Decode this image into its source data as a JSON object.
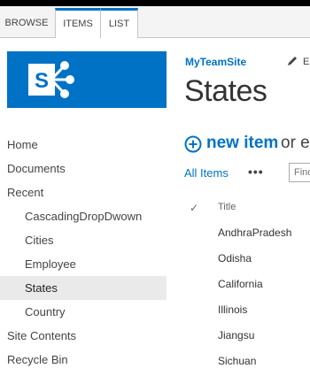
{
  "ribbon": {
    "tabs": [
      "BROWSE",
      "ITEMS",
      "LIST"
    ]
  },
  "site": {
    "name": "MyTeamSite",
    "edit_label": "E"
  },
  "page": {
    "title": "States"
  },
  "quick_launch": {
    "items": [
      {
        "label": "Home"
      },
      {
        "label": "Documents"
      },
      {
        "label": "Recent"
      },
      {
        "label": "CascadingDropDwown"
      },
      {
        "label": "Cities"
      },
      {
        "label": "Employee"
      },
      {
        "label": "States"
      },
      {
        "label": "Country"
      },
      {
        "label": "Site Contents"
      },
      {
        "label": "Recycle Bin"
      }
    ],
    "selected": "States"
  },
  "commands": {
    "new_item": "new item",
    "or_text": "or e",
    "view": "All Items",
    "more": "•••",
    "search_placeholder": "Find"
  },
  "list": {
    "check_glyph": "✓",
    "column": "Title",
    "rows": [
      "AndhraPradesh",
      "Odisha",
      "California",
      "Illinois",
      "Jiangsu",
      "Sichuan"
    ]
  },
  "colors": {
    "accent": "#0072c6",
    "selected_bg": "#eaeaea"
  },
  "icons": [
    "sharepoint-logo-icon",
    "edit-icon",
    "add-circle-icon"
  ]
}
